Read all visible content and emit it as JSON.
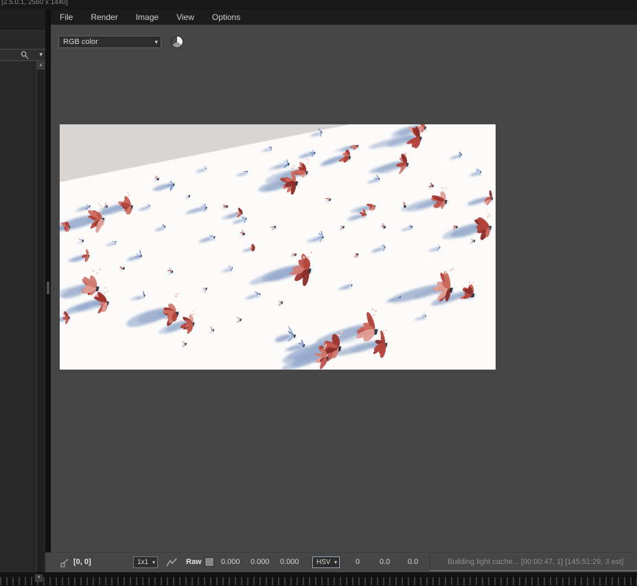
{
  "window": {
    "titlebar_fragment": "[2.5.0.1, 2560 x 1440]"
  },
  "menu": {
    "items": [
      "File",
      "Render",
      "Image",
      "View",
      "Options"
    ]
  },
  "toolbar": {
    "channel_select": "RGB color"
  },
  "statusbar": {
    "pixel_coords": "[0, 0]",
    "zoom_select": "1x1",
    "raw_label": "Raw",
    "raw_values": [
      "0.000",
      "0.000",
      "0.000"
    ],
    "hsv_select": "HSV",
    "hsv_values": [
      "0",
      "0.0",
      "0.0"
    ],
    "message": "Building light cache... [00:00:47, 1] [145:51:29, 3 est]"
  },
  "icons": {
    "dropdown_arrow": "▾",
    "scroll_up": "▲",
    "scroll_down": "▼"
  },
  "render_view": {
    "background": "#d9d5d2",
    "floor": "#fcfbfa",
    "shadow": "#8da3c7",
    "red_palette": [
      "#9e332e",
      "#b2443c",
      "#c25a50",
      "#d17c71",
      "#e09d94",
      "#8a2c28",
      "#cc6a5f"
    ],
    "blue_palette": [
      "#8aa0cc",
      "#a6b6dd",
      "#c3cfe9",
      "#dde4f3",
      "#7b92c2"
    ],
    "sprout_palette": [
      "#d8a3aa",
      "#e9e9ef",
      "#a9b7d7",
      "#c96a62"
    ],
    "plants": [
      [
        0.096,
        0.384,
        1.0,
        "r"
      ],
      [
        0.162,
        0.333,
        0.9,
        "r"
      ],
      [
        0.065,
        0.535,
        0.5,
        "r"
      ],
      [
        0.083,
        0.664,
        1.1,
        "r"
      ],
      [
        0.107,
        0.725,
        0.9,
        "r"
      ],
      [
        0.02,
        0.787,
        0.5,
        "r"
      ],
      [
        0.265,
        0.767,
        1.2,
        "r"
      ],
      [
        0.304,
        0.81,
        0.8,
        "r"
      ],
      [
        0.569,
        0.591,
        1.2,
        "r"
      ],
      [
        0.54,
        0.235,
        1.0,
        "r"
      ],
      [
        0.564,
        0.193,
        0.8,
        "r"
      ],
      [
        0.663,
        0.132,
        0.7,
        "r"
      ],
      [
        0.682,
        0.087,
        0.5,
        "r"
      ],
      [
        0.824,
        0.053,
        1.0,
        "r"
      ],
      [
        0.836,
        0.011,
        0.7,
        "r"
      ],
      [
        0.795,
        0.16,
        0.8,
        "r"
      ],
      [
        0.883,
        0.311,
        0.9,
        "r"
      ],
      [
        0.984,
        0.417,
        1.0,
        "r"
      ],
      [
        0.99,
        0.3,
        0.6,
        "r"
      ],
      [
        0.894,
        0.669,
        1.2,
        "r"
      ],
      [
        0.946,
        0.692,
        0.9,
        "r"
      ],
      [
        0.721,
        0.838,
        1.3,
        "r"
      ],
      [
        0.745,
        0.894,
        1.0,
        "r"
      ],
      [
        0.638,
        0.908,
        1.2,
        "r"
      ],
      [
        0.611,
        0.95,
        0.9,
        "r"
      ],
      [
        0.417,
        0.361,
        0.4,
        "r"
      ],
      [
        0.721,
        0.333,
        0.5,
        "r"
      ],
      [
        0.701,
        0.367,
        0.4,
        "r"
      ],
      [
        0.02,
        0.417,
        0.6,
        "r"
      ],
      [
        0.446,
        0.501,
        0.3,
        "r"
      ],
      [
        0.26,
        0.244,
        0.8,
        "b"
      ],
      [
        0.335,
        0.339,
        0.7,
        "b"
      ],
      [
        0.354,
        0.459,
        0.6,
        "b"
      ],
      [
        0.186,
        0.535,
        0.6,
        "b"
      ],
      [
        0.427,
        0.384,
        0.5,
        "b"
      ],
      [
        0.524,
        0.16,
        0.7,
        "b"
      ],
      [
        0.584,
        0.115,
        0.6,
        "b"
      ],
      [
        0.6,
        0.031,
        0.5,
        "b"
      ],
      [
        0.732,
        0.221,
        0.5,
        "b"
      ],
      [
        0.603,
        0.459,
        0.6,
        "b"
      ],
      [
        0.537,
        0.86,
        1.0,
        "b"
      ],
      [
        0.559,
        0.899,
        0.8,
        "b"
      ],
      [
        0.458,
        0.692,
        0.5,
        "b"
      ],
      [
        0.395,
        0.585,
        0.4,
        "b"
      ],
      [
        0.194,
        0.697,
        0.5,
        "b"
      ],
      [
        0.068,
        0.333,
        0.5,
        "b"
      ],
      [
        0.241,
        0.417,
        0.4,
        "b"
      ],
      [
        0.745,
        0.501,
        0.5,
        "b"
      ],
      [
        0.808,
        0.417,
        0.4,
        "b"
      ],
      [
        0.871,
        0.501,
        0.4,
        "b"
      ],
      [
        0.965,
        0.193,
        0.5,
        "b"
      ],
      [
        0.921,
        0.123,
        0.4,
        "b"
      ],
      [
        0.669,
        0.655,
        0.5,
        "b"
      ],
      [
        0.78,
        0.703,
        0.5,
        "b"
      ],
      [
        0.839,
        0.781,
        0.4,
        "b"
      ],
      [
        0.43,
        0.193,
        0.4,
        "b"
      ],
      [
        0.485,
        0.095,
        0.4,
        "b"
      ],
      [
        0.335,
        0.179,
        0.4,
        "b"
      ],
      [
        0.206,
        0.333,
        0.4,
        "b"
      ],
      [
        0.128,
        0.479,
        0.4,
        "b"
      ],
      [
        0.225,
        0.221,
        0.35,
        "s"
      ],
      [
        0.296,
        0.291,
        0.35,
        "s"
      ],
      [
        0.383,
        0.333,
        0.35,
        "s"
      ],
      [
        0.422,
        0.445,
        0.35,
        "s"
      ],
      [
        0.493,
        0.417,
        0.35,
        "s"
      ],
      [
        0.257,
        0.599,
        0.35,
        "s"
      ],
      [
        0.335,
        0.669,
        0.35,
        "s"
      ],
      [
        0.619,
        0.305,
        0.35,
        "s"
      ],
      [
        0.65,
        0.417,
        0.35,
        "s"
      ],
      [
        0.745,
        0.417,
        0.35,
        "s"
      ],
      [
        0.792,
        0.333,
        0.35,
        "s"
      ],
      [
        0.855,
        0.249,
        0.35,
        "s"
      ],
      [
        0.91,
        0.417,
        0.35,
        "s"
      ],
      [
        0.95,
        0.473,
        0.35,
        "s"
      ],
      [
        0.54,
        0.529,
        0.35,
        "s"
      ],
      [
        0.682,
        0.529,
        0.35,
        "s"
      ],
      [
        0.509,
        0.725,
        0.35,
        "s"
      ],
      [
        0.414,
        0.795,
        0.35,
        "s"
      ],
      [
        0.351,
        0.838,
        0.35,
        "s"
      ],
      [
        0.288,
        0.894,
        0.35,
        "s"
      ],
      [
        0.146,
        0.585,
        0.35,
        "s"
      ],
      [
        0.052,
        0.473,
        0.35,
        "s"
      ],
      [
        0.107,
        0.333,
        0.35,
        "s"
      ]
    ]
  }
}
